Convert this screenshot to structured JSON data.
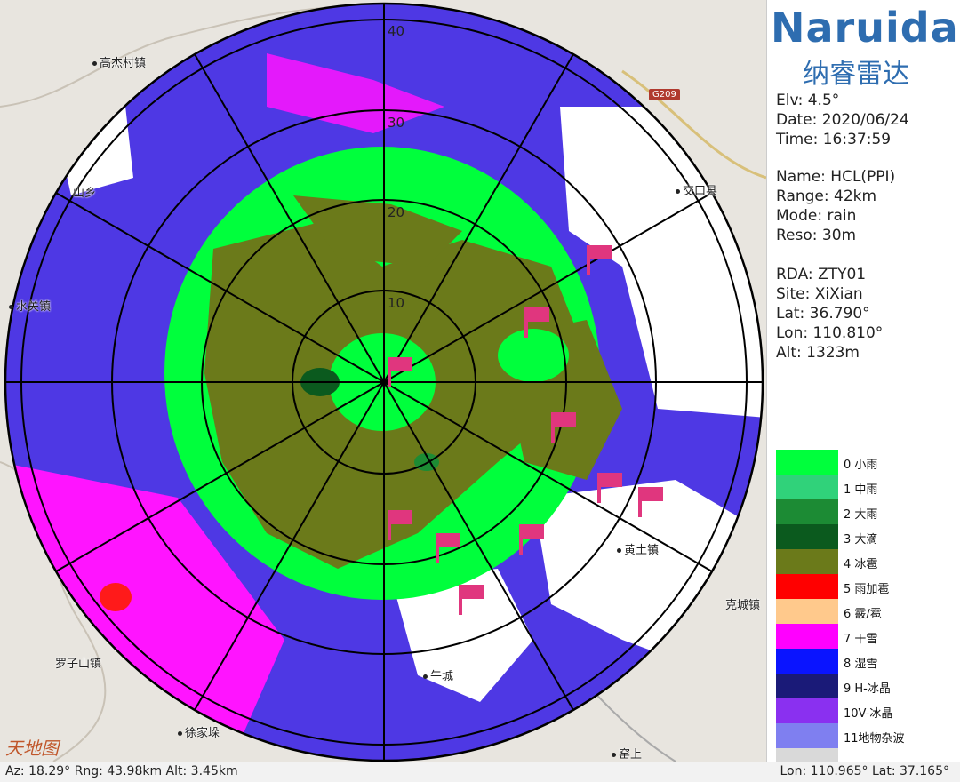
{
  "brand": {
    "name": "Naruida",
    "name_cn": "纳睿雷达"
  },
  "scan": {
    "elv": "Elv: 4.5°",
    "date": "Date: 2020/06/24",
    "time": "Time: 16:37:59",
    "name": "Name: HCL(PPI)",
    "range": "Range: 42km",
    "mode": "Mode: rain",
    "reso": "Reso: 30m",
    "rda": "RDA: ZTY01",
    "site": "Site: XiXian",
    "lat": "Lat: 36.790°",
    "lon": "Lon: 110.810°",
    "alt": "Alt: 1323m"
  },
  "rings": {
    "r10": "10",
    "r20": "20",
    "r30": "30",
    "r40": "40"
  },
  "map": {
    "places": [
      "高杰村镇",
      "交口县",
      "山乡",
      "水关镇",
      "黄土镇",
      "克城镇",
      "罗子山镇",
      "午城",
      "徐家垛",
      "窑上"
    ],
    "road": "G209",
    "watermark": "天地图"
  },
  "legend": [
    {
      "label": "0  小雨",
      "color": "#00ff3c"
    },
    {
      "label": "1  中雨",
      "color": "#30d27a"
    },
    {
      "label": "2  大雨",
      "color": "#1c8b34"
    },
    {
      "label": "3  大滴",
      "color": "#0b5a1e"
    },
    {
      "label": "4  冰雹",
      "color": "#6b7a1a"
    },
    {
      "label": "5  雨加雹",
      "color": "#ff0000"
    },
    {
      "label": "6  霰/雹",
      "color": "#ffc98c"
    },
    {
      "label": "7  干雪",
      "color": "#ff00ff"
    },
    {
      "label": "8  湿雪",
      "color": "#0a14ff"
    },
    {
      "label": "9  H-冰晶",
      "color": "#1a1a78"
    },
    {
      "label": "10V-冰晶",
      "color": "#8a30f0"
    },
    {
      "label": "11地物杂波",
      "color": "#7f7ff0"
    },
    {
      "label": "",
      "color": "#d9d9d9"
    }
  ],
  "status": {
    "left": "Az: 18.29°  Rng: 43.98km  Alt: 3.45km",
    "right": "Lon: 110.965°  Lat: 37.165°"
  }
}
